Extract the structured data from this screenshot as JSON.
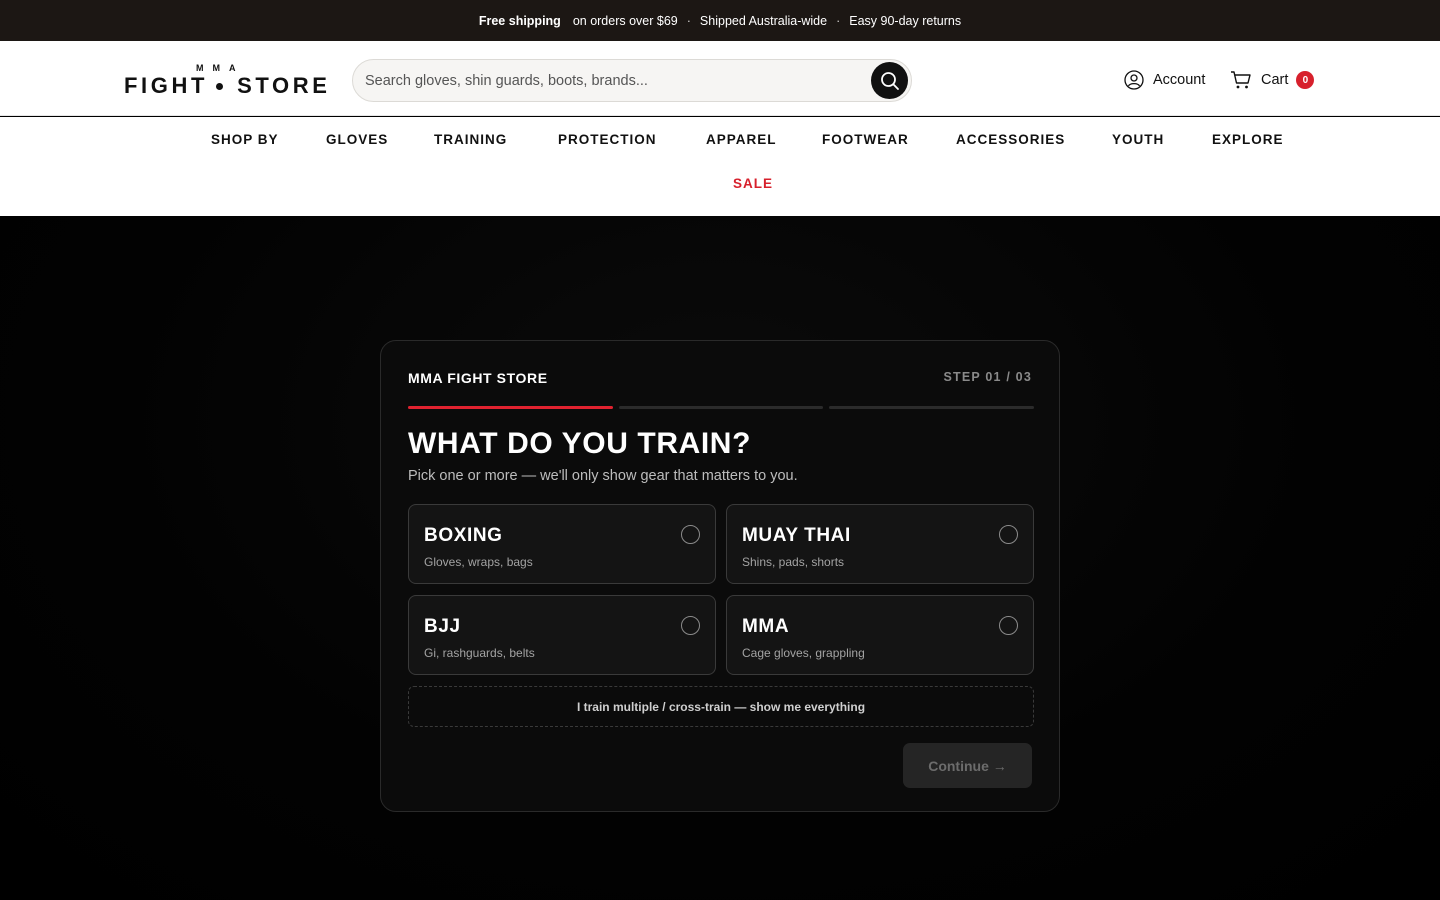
{
  "announcement": {
    "strong": "Free shipping",
    "text1": "on orders over $69",
    "separator": "·",
    "text2": "Shipped Australia-wide",
    "text3": "Easy 90-day returns"
  },
  "header": {
    "logo_top": "MMA",
    "logo_left": "FIGHT",
    "logo_right": "STORE",
    "search_placeholder": "Search gloves, shin guards, boots, brands...",
    "account_label": "Account",
    "cart_label": "Cart",
    "cart_count": "0"
  },
  "nav": {
    "items": [
      "SHOP BY",
      "GLOVES",
      "TRAINING",
      "PROTECTION",
      "APPAREL",
      "FOOTWEAR",
      "ACCESSORIES",
      "YOUTH",
      "EXPLORE"
    ],
    "sale": "SALE"
  },
  "quiz": {
    "brand": "MMA FIGHT STORE",
    "step": "STEP 01 / 03",
    "progress": {
      "current_step": 1,
      "total_steps": 3
    },
    "title": "WHAT DO YOU TRAIN?",
    "subtitle": "Pick one or more — we'll only show gear that matters to you.",
    "options": [
      {
        "title": "BOXING",
        "desc": "Gloves, wraps, bags"
      },
      {
        "title": "MUAY THAI",
        "desc": "Shins, pads, shorts"
      },
      {
        "title": "BJJ",
        "desc": "Gi, rashguards, belts"
      },
      {
        "title": "MMA",
        "desc": "Cage gloves, grappling"
      }
    ],
    "cross_train": "I train multiple / cross-train — show me everything",
    "continue_label": "Continue →"
  },
  "colors": {
    "accent": "#e0222f",
    "announce_bg": "#1c1714",
    "card_bg": "#0b0b0b"
  }
}
